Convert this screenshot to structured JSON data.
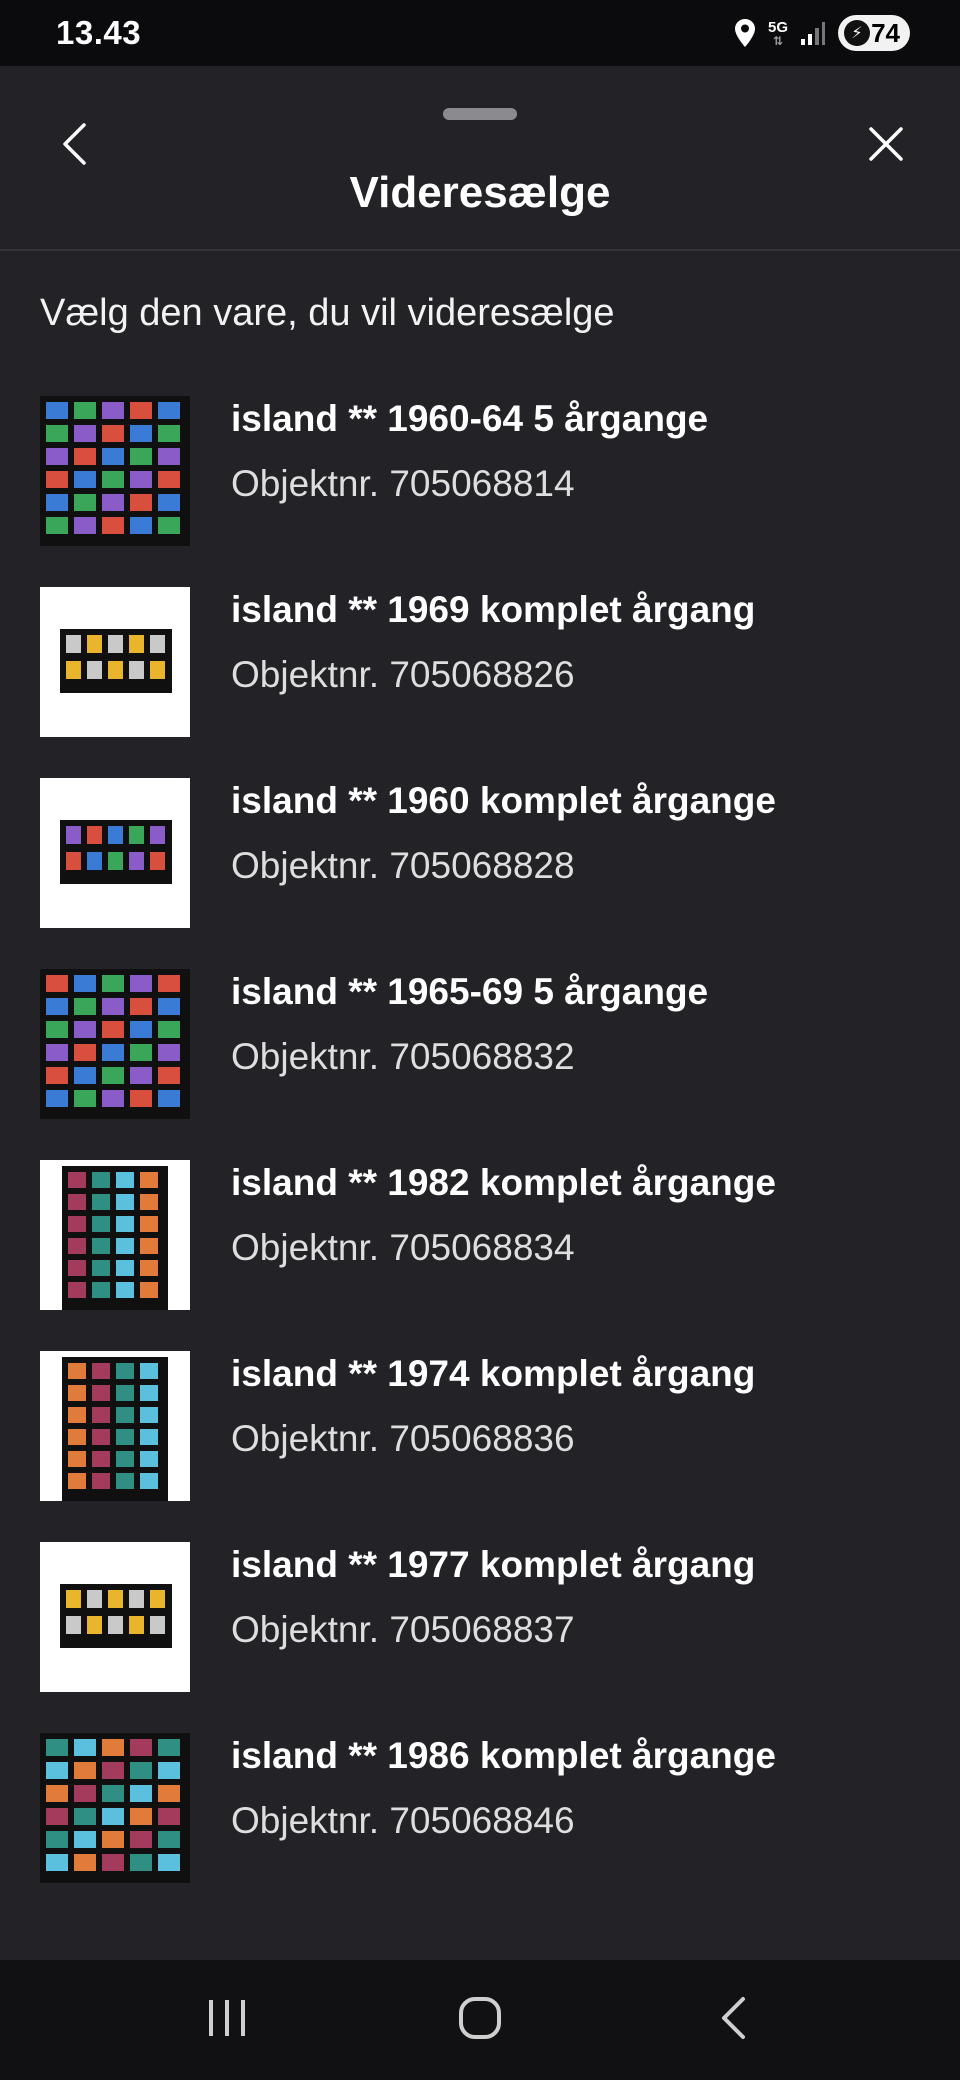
{
  "status_bar": {
    "time": "13.43",
    "network": "5G",
    "battery_level": "74",
    "icons": [
      "location-icon",
      "network-5g-icon",
      "signal-icon",
      "battery-icon"
    ]
  },
  "sheet": {
    "title": "Videresælge",
    "subtitle": "Vælg den vare, du vil videresælge",
    "icons": [
      "back-icon",
      "close-icon"
    ]
  },
  "items": [
    {
      "title": "island ** 1960-64 5 årgange",
      "object": "Objektnr. 705068814",
      "thumb": "dense"
    },
    {
      "title": "island ** 1969 komplet årgang",
      "object": "Objektnr. 705068826",
      "thumb": "small"
    },
    {
      "title": "island ** 1960 komplet årgange",
      "object": "Objektnr. 705068828",
      "thumb": "small"
    },
    {
      "title": "island ** 1965-69 5 årgange",
      "object": "Objektnr. 705068832",
      "thumb": "dense"
    },
    {
      "title": "island ** 1982 komplet årgange",
      "object": "Objektnr. 705068834",
      "thumb": "tall"
    },
    {
      "title": "island ** 1974 komplet årgang",
      "object": "Objektnr. 705068836",
      "thumb": "tall"
    },
    {
      "title": "island ** 1977 komplet årgang",
      "object": "Objektnr. 705068837",
      "thumb": "small"
    },
    {
      "title": "island ** 1986 komplet årgange",
      "object": "Objektnr. 705068846",
      "thumb": "dense"
    }
  ],
  "nav_bar": {
    "icons": [
      "recent-apps-icon",
      "home-icon",
      "nav-back-icon"
    ]
  },
  "colors": {
    "sheet_bg": "#222227",
    "status_bg": "#0b0b0d",
    "text_primary": "#ffffff",
    "text_secondary": "#dedede"
  }
}
